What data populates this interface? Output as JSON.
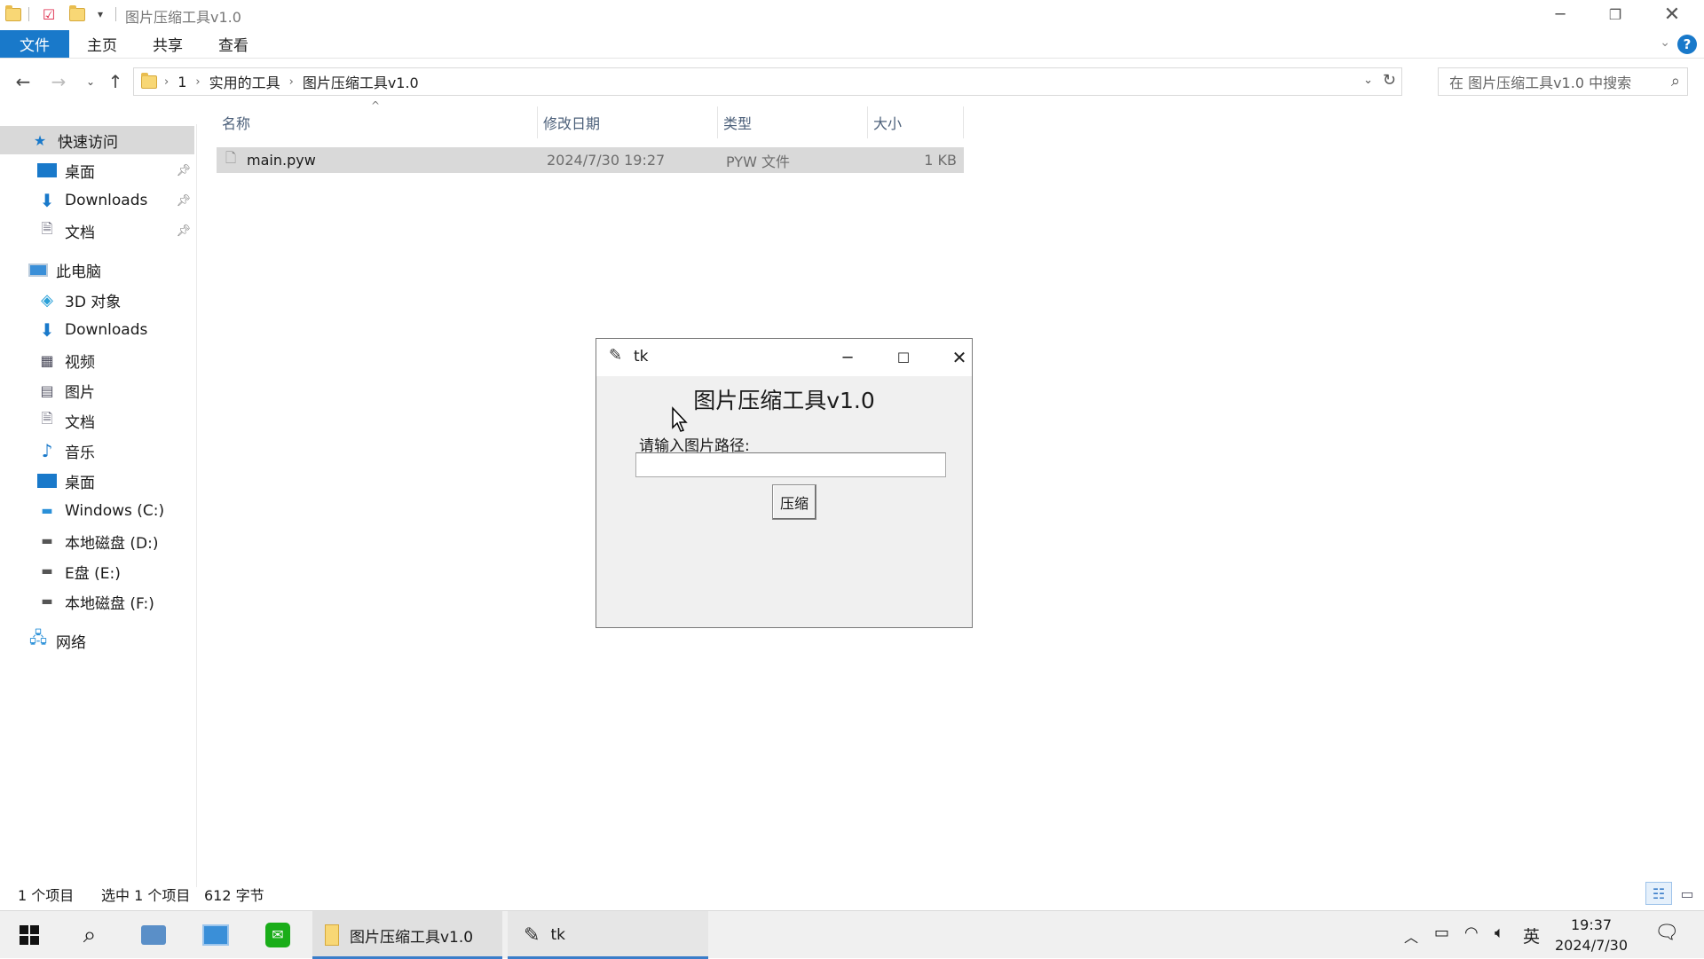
{
  "window": {
    "title": "图片压缩工具v1.0"
  },
  "ribbon": {
    "tabs": [
      "文件",
      "主页",
      "共享",
      "查看"
    ]
  },
  "address": {
    "crumbs": [
      "1",
      "实用的工具",
      "图片压缩工具v1.0"
    ],
    "search_placeholder": "在 图片压缩工具v1.0 中搜索"
  },
  "sidebar": {
    "quick_access": "快速访问",
    "quick_items": [
      "桌面",
      "Downloads",
      "文档"
    ],
    "this_pc": "此电脑",
    "pc_items": [
      "3D 对象",
      "Downloads",
      "视频",
      "图片",
      "文档",
      "音乐",
      "桌面",
      "Windows (C:)",
      "本地磁盘 (D:)",
      "E盘 (E:)",
      "本地磁盘 (F:)"
    ],
    "network": "网络"
  },
  "columns": {
    "name": "名称",
    "date": "修改日期",
    "type": "类型",
    "size": "大小"
  },
  "files": [
    {
      "name": "main.pyw",
      "date": "2024/7/30 19:27",
      "type": "PYW 文件",
      "size": "1 KB"
    }
  ],
  "tk": {
    "title": "tk",
    "heading": "图片压缩工具v1.0",
    "label": "请输入图片路径:",
    "input_value": "",
    "button": "压缩"
  },
  "status": {
    "count": "1 个项目",
    "selected": "选中 1 个项目",
    "size": "612 字节"
  },
  "taskbar": {
    "explorer_label": "图片压缩工具v1.0",
    "tk_label": "tk"
  },
  "tray": {
    "ime": "英",
    "time": "19:37",
    "date": "2024/7/30"
  },
  "colors": {
    "accent": "#1979ca",
    "selection": "#d9d9d9"
  }
}
